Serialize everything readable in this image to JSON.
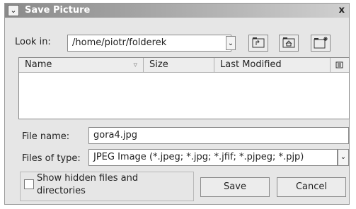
{
  "window": {
    "title": "Save Picture",
    "menu_glyph": "⌄",
    "close_glyph": "x"
  },
  "look_in": {
    "label": "Look in:",
    "path": "/home/piotr/folderek",
    "dropdown_glyph": "⌄"
  },
  "toolbar": {
    "up_icon": "folder-up-icon",
    "home_icon": "folder-home-icon",
    "new_folder_icon": "new-folder-icon"
  },
  "file_list": {
    "columns": [
      "Name",
      "Size",
      "Last Modified"
    ],
    "sort_glyph": "▿",
    "view_icon": "detail-view-icon",
    "items": []
  },
  "file_name": {
    "label": "File name:",
    "value": "gora4.jpg"
  },
  "files_of_type": {
    "label": "Files of type:",
    "value": "JPEG Image (*.jpeg; *.jpg; *.jfif; *.pjpeg; *.pjp)",
    "dropdown_glyph": "⌄"
  },
  "show_hidden": {
    "line1": "Show hidden files and",
    "line2": "directories",
    "checked": false
  },
  "buttons": {
    "save": "Save",
    "cancel": "Cancel"
  }
}
